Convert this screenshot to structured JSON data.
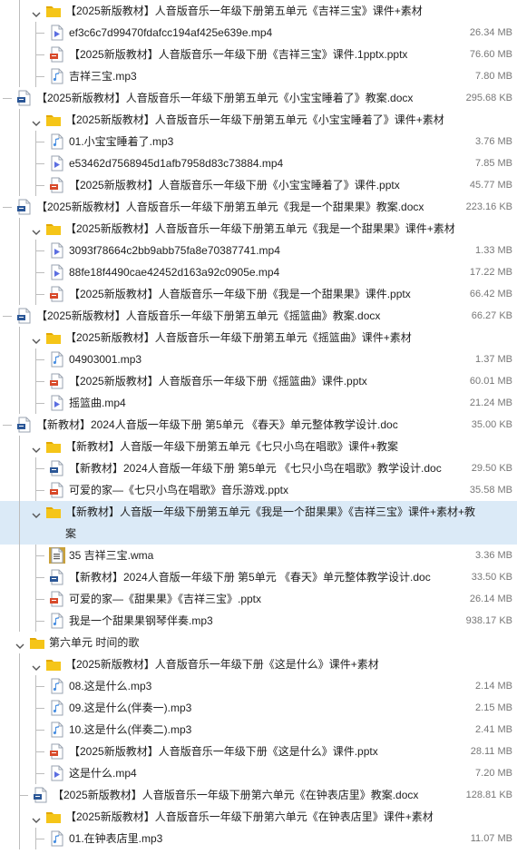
{
  "rows": [
    {
      "depth": 2,
      "kind": "folder",
      "expanded": true,
      "name": "【2025新版教材】人音版音乐一年级下册第五单元《吉祥三宝》课件+素材",
      "size": ""
    },
    {
      "depth": 3,
      "kind": "video",
      "name": "ef3c6c7d99470fdafcc194af425e639e.mp4",
      "size": "26.34 MB"
    },
    {
      "depth": 3,
      "kind": "pptx",
      "name": "【2025新版教材】人音版音乐一年级下册《吉祥三宝》课件.1pptx.pptx",
      "size": "76.60 MB"
    },
    {
      "depth": 3,
      "kind": "audio",
      "name": "吉祥三宝.mp3",
      "size": "7.80 MB"
    },
    {
      "depth": 1,
      "kind": "doc",
      "name": "【2025新版教材】人音版音乐一年级下册第五单元《小宝宝睡着了》教案.docx",
      "size": "295.68 KB"
    },
    {
      "depth": 2,
      "kind": "folder",
      "expanded": true,
      "name": "【2025新版教材】人音版音乐一年级下册第五单元《小宝宝睡着了》课件+素材",
      "size": ""
    },
    {
      "depth": 3,
      "kind": "audio",
      "name": "01.小宝宝睡着了.mp3",
      "size": "3.76 MB"
    },
    {
      "depth": 3,
      "kind": "video",
      "name": "e53462d7568945d1afb7958d83c73884.mp4",
      "size": "7.85 MB"
    },
    {
      "depth": 3,
      "kind": "pptx",
      "name": "【2025新版教材】人音版音乐一年级下册《小宝宝睡着了》课件.pptx",
      "size": "45.77 MB"
    },
    {
      "depth": 1,
      "kind": "doc",
      "name": "【2025新版教材】人音版音乐一年级下册第五单元《我是一个甜果果》教案.docx",
      "size": "223.16 KB"
    },
    {
      "depth": 2,
      "kind": "folder",
      "expanded": true,
      "name": "【2025新版教材】人音版音乐一年级下册第五单元《我是一个甜果果》课件+素材",
      "size": ""
    },
    {
      "depth": 3,
      "kind": "video",
      "name": "3093f78664c2bb9abb75fa8e70387741.mp4",
      "size": "1.33 MB"
    },
    {
      "depth": 3,
      "kind": "video",
      "name": "88fe18f4490cae42452d163a92c0905e.mp4",
      "size": "17.22 MB"
    },
    {
      "depth": 3,
      "kind": "pptx",
      "name": "【2025新版教材】人音版音乐一年级下册《我是一个甜果果》课件.pptx",
      "size": "66.42 MB"
    },
    {
      "depth": 1,
      "kind": "doc",
      "name": "【2025新版教材】人音版音乐一年级下册第五单元《摇篮曲》教案.docx",
      "size": "66.27 KB"
    },
    {
      "depth": 2,
      "kind": "folder",
      "expanded": true,
      "name": "【2025新版教材】人音版音乐一年级下册第五单元《摇篮曲》课件+素材",
      "size": ""
    },
    {
      "depth": 3,
      "kind": "audio",
      "name": "04903001.mp3",
      "size": "1.37 MB"
    },
    {
      "depth": 3,
      "kind": "pptx",
      "name": "【2025新版教材】人音版音乐一年级下册《摇篮曲》课件.pptx",
      "size": "60.01 MB"
    },
    {
      "depth": 3,
      "kind": "video",
      "name": "摇篮曲.mp4",
      "size": "21.24 MB"
    },
    {
      "depth": 1,
      "kind": "doc",
      "name": "【新教材】2024人音版一年级下册 第5单元 《春天》单元整体教学设计.doc",
      "size": "35.00 KB"
    },
    {
      "depth": 2,
      "kind": "folder",
      "expanded": true,
      "name": "【新教材】人音版一年级下册第五单元《七只小鸟在唱歌》课件+教案",
      "size": ""
    },
    {
      "depth": 3,
      "kind": "doc",
      "name": "【新教材】2024人音版一年级下册 第5单元 《七只小鸟在唱歌》教学设计.doc",
      "size": "29.50 KB"
    },
    {
      "depth": 3,
      "kind": "pptx",
      "name": "可爱的家—《七只小鸟在唱歌》音乐游戏.pptx",
      "size": "35.58 MB"
    },
    {
      "depth": 2,
      "kind": "folder",
      "expanded": true,
      "selected": true,
      "tall": true,
      "name": "【新教材】人音版一年级下册第五单元《我是一个甜果果》《吉祥三宝》课件+素材+教案",
      "size": ""
    },
    {
      "depth": 3,
      "kind": "wma",
      "name": "35 吉祥三宝.wma",
      "size": "3.36 MB"
    },
    {
      "depth": 3,
      "kind": "doc",
      "name": "【新教材】2024人音版一年级下册 第5单元 《春天》单元整体教学设计.doc",
      "size": "33.50 KB"
    },
    {
      "depth": 3,
      "kind": "pptx",
      "name": "可爱的家—《甜果果》《吉祥三宝》.pptx",
      "size": "26.14 MB"
    },
    {
      "depth": 3,
      "kind": "audio",
      "name": "我是一个甜果果钢琴伴奏.mp3",
      "size": "938.17 KB"
    },
    {
      "depth": 1,
      "kind": "folder",
      "expanded": true,
      "name": "第六单元 时间的歌",
      "size": ""
    },
    {
      "depth": 2,
      "kind": "folder",
      "expanded": true,
      "name": "【2025新版教材】人音版音乐一年级下册《这是什么》课件+素材",
      "size": ""
    },
    {
      "depth": 3,
      "kind": "audio",
      "name": "08.这是什么.mp3",
      "size": "2.14 MB"
    },
    {
      "depth": 3,
      "kind": "audio",
      "name": "09.这是什么(伴奏一).mp3",
      "size": "2.15 MB"
    },
    {
      "depth": 3,
      "kind": "audio",
      "name": "10.这是什么(伴奏二).mp3",
      "size": "2.41 MB"
    },
    {
      "depth": 3,
      "kind": "pptx",
      "name": "【2025新版教材】人音版音乐一年级下册《这是什么》课件.pptx",
      "size": "28.11 MB"
    },
    {
      "depth": 3,
      "kind": "video",
      "name": "这是什么.mp4",
      "size": "7.20 MB"
    },
    {
      "depth": 2,
      "kind": "doc",
      "name": "【2025新版教材】人音版音乐一年级下册第六单元《在钟表店里》教案.docx",
      "size": "128.81 KB"
    },
    {
      "depth": 2,
      "kind": "folder",
      "expanded": true,
      "name": "【2025新版教材】人音版音乐一年级下册第六单元《在钟表店里》课件+素材",
      "size": ""
    },
    {
      "depth": 3,
      "kind": "audio",
      "name": "01.在钟表店里.mp3",
      "size": "11.07 MB"
    }
  ],
  "colors": {
    "folder": "#f5c518",
    "folder_dark": "#e2a700",
    "video": "#5b6ee1",
    "audio": "#4a90e2",
    "pptx": "#d84a2b",
    "doc": "#2b5797",
    "wma": "#c9a13a",
    "selected": "#dbeaf7"
  }
}
